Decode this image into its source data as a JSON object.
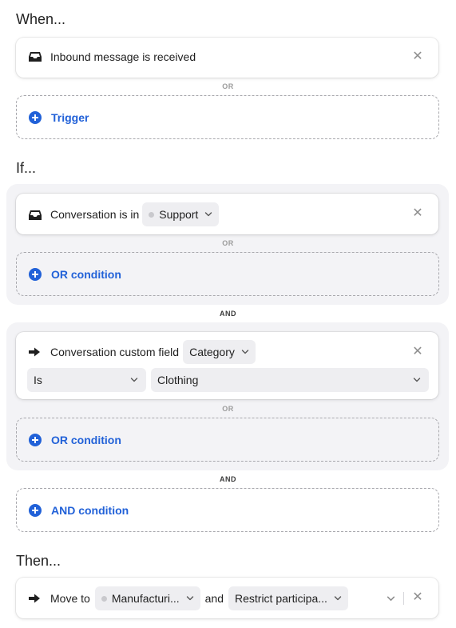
{
  "when": {
    "title": "When...",
    "trigger_label": "Inbound message is received",
    "or_label": "OR",
    "add_trigger": "Trigger"
  },
  "if": {
    "title": "If...",
    "group1": {
      "prefix": "Conversation is in",
      "value": "Support",
      "or_label": "OR",
      "add_or": "OR condition"
    },
    "and_label_1": "AND",
    "group2": {
      "prefix": "Conversation custom field",
      "field": "Category",
      "operator": "Is",
      "value": "Clothing",
      "or_label": "OR",
      "add_or": "OR condition"
    },
    "and_label_2": "AND",
    "add_and": "AND condition"
  },
  "then": {
    "title": "Then...",
    "prefix": "Move to",
    "destination": "Manufacturi...",
    "connector": "and",
    "option": "Restrict participa..."
  },
  "colors": {
    "accent": "#2161d8",
    "group_bg": "#f3f3f6",
    "pill_bg": "#eeeef1"
  }
}
